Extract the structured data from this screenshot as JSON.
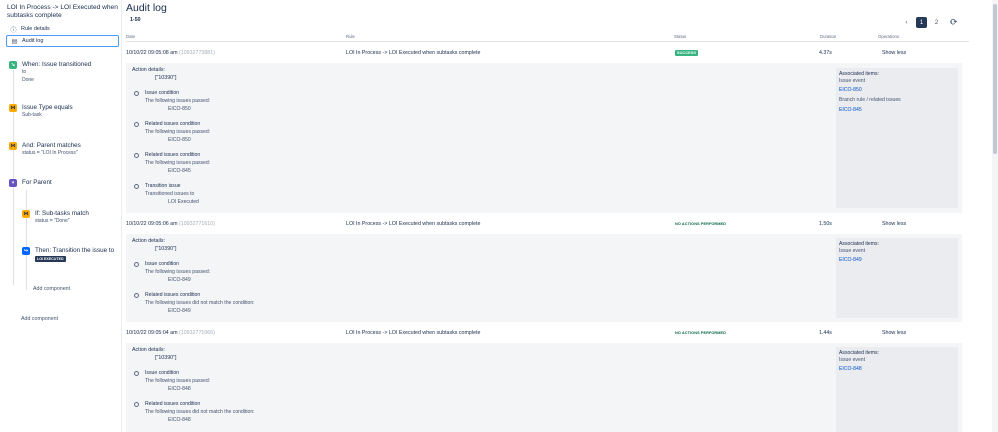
{
  "sidebar": {
    "rule_title": "LOI In Process -> LOI Executed when subtasks complete",
    "nav": [
      {
        "label": "Rule details",
        "icon": "info-icon"
      },
      {
        "label": "Audit log",
        "icon": "document-icon"
      }
    ],
    "components": {
      "trigger": {
        "title": "When: Issue transitioned",
        "line1": "to",
        "line2": "Done"
      },
      "cond1": {
        "title": "Issue Type equals",
        "sub": "Sub-task"
      },
      "cond2": {
        "title": "And: Parent matches",
        "sub": "status = \"LOI In Process\""
      },
      "branch": {
        "title": "For Parent"
      },
      "cond3": {
        "title": "If: Sub-tasks match",
        "sub": "status = \"Done\""
      },
      "action": {
        "title": "Then: Transition the issue to",
        "badge": "LOI EXECUTED"
      }
    },
    "add_component_inner": "Add component",
    "add_component_outer": "Add component"
  },
  "main": {
    "title": "Audit log",
    "range": "1-50",
    "pagination": {
      "prev": "‹",
      "pages": [
        "1",
        "2"
      ],
      "next": "›",
      "refresh": "⟳"
    },
    "columns": {
      "date": "Date",
      "rule": "Rule",
      "status": "Status",
      "duration": "Duration",
      "operations": "Operations"
    },
    "rows": [
      {
        "date": "10/10/22 09:05:08 am",
        "uid": "(10932773881)",
        "rule": "LOI In Process -> LOI Executed when subtasks complete",
        "status": "SUCCESS",
        "duration": "4.37s",
        "op": "Show less",
        "action_label": "Action details:",
        "action_value": "[\"10390\"]",
        "entries": [
          {
            "title": "Issue condition",
            "sub": "The following issues passed:",
            "issue": "EICO-850"
          },
          {
            "title": "Related issues condition",
            "sub": "The following issues passed:",
            "issue": "EICO-850"
          },
          {
            "title": "Related issues condition",
            "sub": "The following issues passed:",
            "issue": "EICO-845"
          },
          {
            "title": "Transition issue",
            "sub": "Transitioned issues to",
            "issue": "LOI Executed"
          }
        ],
        "assoc": {
          "title": "Associated items:",
          "lines": [
            {
              "type": "label",
              "text": "Issue event"
            },
            {
              "type": "link",
              "text": "EICO-850"
            },
            {
              "type": "label",
              "text": "Branch rule / related issues"
            },
            {
              "type": "link",
              "text": "EICO-845"
            }
          ]
        }
      },
      {
        "date": "10/10/22 09:05:06 am",
        "uid": "(10932771610)",
        "rule": "LOI In Process -> LOI Executed when subtasks complete",
        "status": "NO ACTIONS PERFORMED",
        "duration": "1.50s",
        "op": "Show less",
        "action_label": "Action details:",
        "action_value": "[\"10390\"]",
        "entries": [
          {
            "title": "Issue condition",
            "sub": "The following issues passed:",
            "issue": "EICO-849"
          },
          {
            "title": "Related issues condition",
            "sub": "The following issues did not match the condition:",
            "issue": "EICO-849"
          }
        ],
        "assoc": {
          "title": "Associated items:",
          "lines": [
            {
              "type": "label",
              "text": "Issue event"
            },
            {
              "type": "link",
              "text": "EICO-849"
            }
          ]
        }
      },
      {
        "date": "10/10/22 09:05:04 am",
        "uid": "(10932771066)",
        "rule": "LOI In Process -> LOI Executed when subtasks complete",
        "status": "NO ACTIONS PERFORMED",
        "duration": "1.44s",
        "op": "Show less",
        "action_label": "Action details:",
        "action_value": "[\"10390\"]",
        "entries": [
          {
            "title": "Issue condition",
            "sub": "The following issues passed:",
            "issue": "EICO-848"
          },
          {
            "title": "Related issues condition",
            "sub": "The following issues did not match the condition:",
            "issue": "EICO-848"
          }
        ],
        "assoc": {
          "title": "Associated items:",
          "lines": [
            {
              "type": "label",
              "text": "Issue event"
            },
            {
              "type": "link",
              "text": "EICO-848"
            }
          ]
        }
      }
    ]
  },
  "colors": {
    "accent": "#0052cc",
    "success": "#36b37e",
    "no_action": "#006644",
    "dark": "#253858"
  }
}
